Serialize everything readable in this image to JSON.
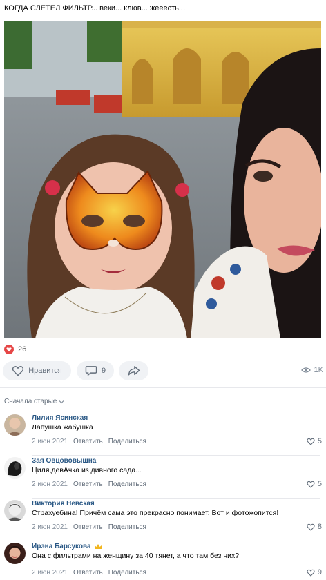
{
  "post": {
    "text": "КОГДА СЛЕТЕЛ ФИЛЬТР... веки... клюв... жееесть..."
  },
  "reactions": {
    "count": "26"
  },
  "actions": {
    "like_label": "Нравится",
    "comments_count": "9",
    "views": "1K"
  },
  "comments": {
    "sort_label": "Сначала старые",
    "items": [
      {
        "author": "Лилия Ясинская",
        "text": "Лапушка жабушка",
        "date": "2 июн 2021",
        "reply": "Ответить",
        "share": "Поделиться",
        "likes": "5"
      },
      {
        "author": "Зая Овцововышна",
        "text": "Циля,девАчка из дивного сада...",
        "date": "2 июн 2021",
        "reply": "Ответить",
        "share": "Поделиться",
        "likes": "5"
      },
      {
        "author": "Виктория Невская",
        "text": "Страхуебина! Причём сама это прекрасно понимает. Вот и фотожопится!",
        "date": "2 июн 2021",
        "reply": "Ответить",
        "share": "Поделиться",
        "likes": "8"
      },
      {
        "author": "Ирэна Барсукова",
        "text": "Она с фильтрами на женщину за 40 тянет, а что там без них?",
        "date": "2 июн 2021",
        "reply": "Ответить",
        "share": "Поделиться",
        "likes": "9"
      }
    ]
  },
  "colors": {
    "accent": "#2a5885",
    "heart": "#e64646",
    "pill_bg": "#f0f2f5",
    "muted": "#818c99"
  },
  "icons": [
    "heart-icon",
    "comment-icon",
    "share-icon",
    "eye-icon",
    "chevron-down-icon",
    "crown-icon"
  ]
}
